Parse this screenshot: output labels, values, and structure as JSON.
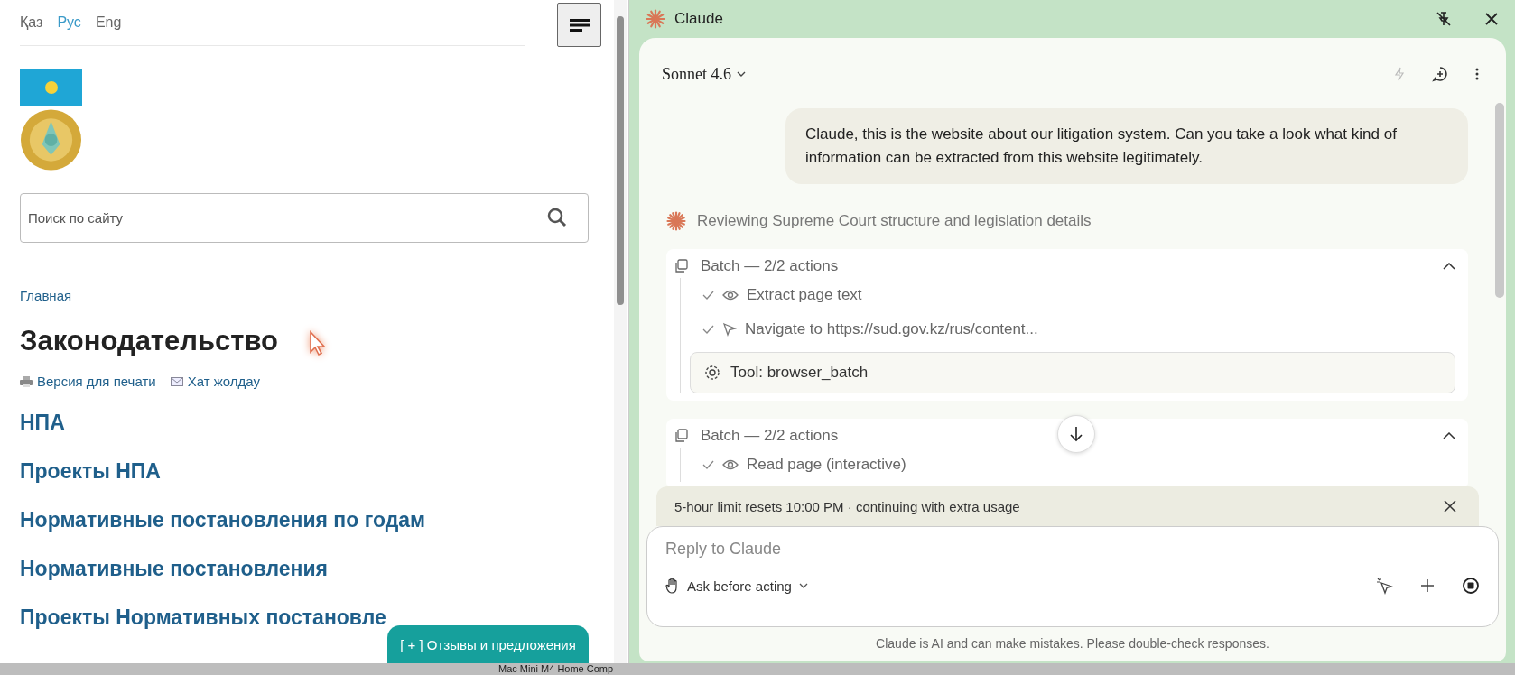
{
  "browser": {
    "languages": [
      {
        "label": "Қаз",
        "selected": false
      },
      {
        "label": "Рус",
        "selected": true
      },
      {
        "label": "Eng",
        "selected": false
      }
    ],
    "search": {
      "placeholder": "Поиск по сайту"
    },
    "breadcrumb": "Главная",
    "title": "Законодательство",
    "page_links": [
      {
        "kind": "print",
        "label": "Версия для печати"
      },
      {
        "kind": "mail",
        "label": "Хат жолдау"
      }
    ],
    "nav_links": [
      "НПА",
      "Проекты НПА",
      "Нормативные постановления по годам",
      "Нормативные постановления",
      "Проекты Нормативных постановле"
    ],
    "feedback_button": "[ + ] Отзывы и предложения"
  },
  "assistant": {
    "title": "Claude",
    "model": "Sonnet 4.6",
    "user_message": "Claude, this is the website about our litigation system. Can you take a look what kind of information can be extracted from this website legitimately.",
    "status": "Reviewing Supreme Court structure and legislation details",
    "batches": [
      {
        "title": "Batch — 2/2 actions",
        "expanded": true,
        "actions": [
          {
            "kind": "view",
            "label": "Extract page text",
            "done": true
          },
          {
            "kind": "navigate",
            "label": "Navigate to https://sud.gov.kz/rus/content...",
            "done": true
          }
        ],
        "tool": "Tool: browser_batch"
      },
      {
        "title": "Batch — 2/2 actions",
        "expanded": true,
        "actions": [
          {
            "kind": "view",
            "label": "Read page (interactive)",
            "done": true
          }
        ]
      }
    ],
    "notice": "5-hour limit resets 10:00 PM · continuing with extra usage",
    "input": {
      "placeholder": "Reply to Claude"
    },
    "mode": "Ask before acting",
    "disclaimer": "Claude is AI and can make mistakes. Please double-check responses."
  },
  "taskbar": {
    "window_label": "Mac Mini M4 Home Comp"
  }
}
